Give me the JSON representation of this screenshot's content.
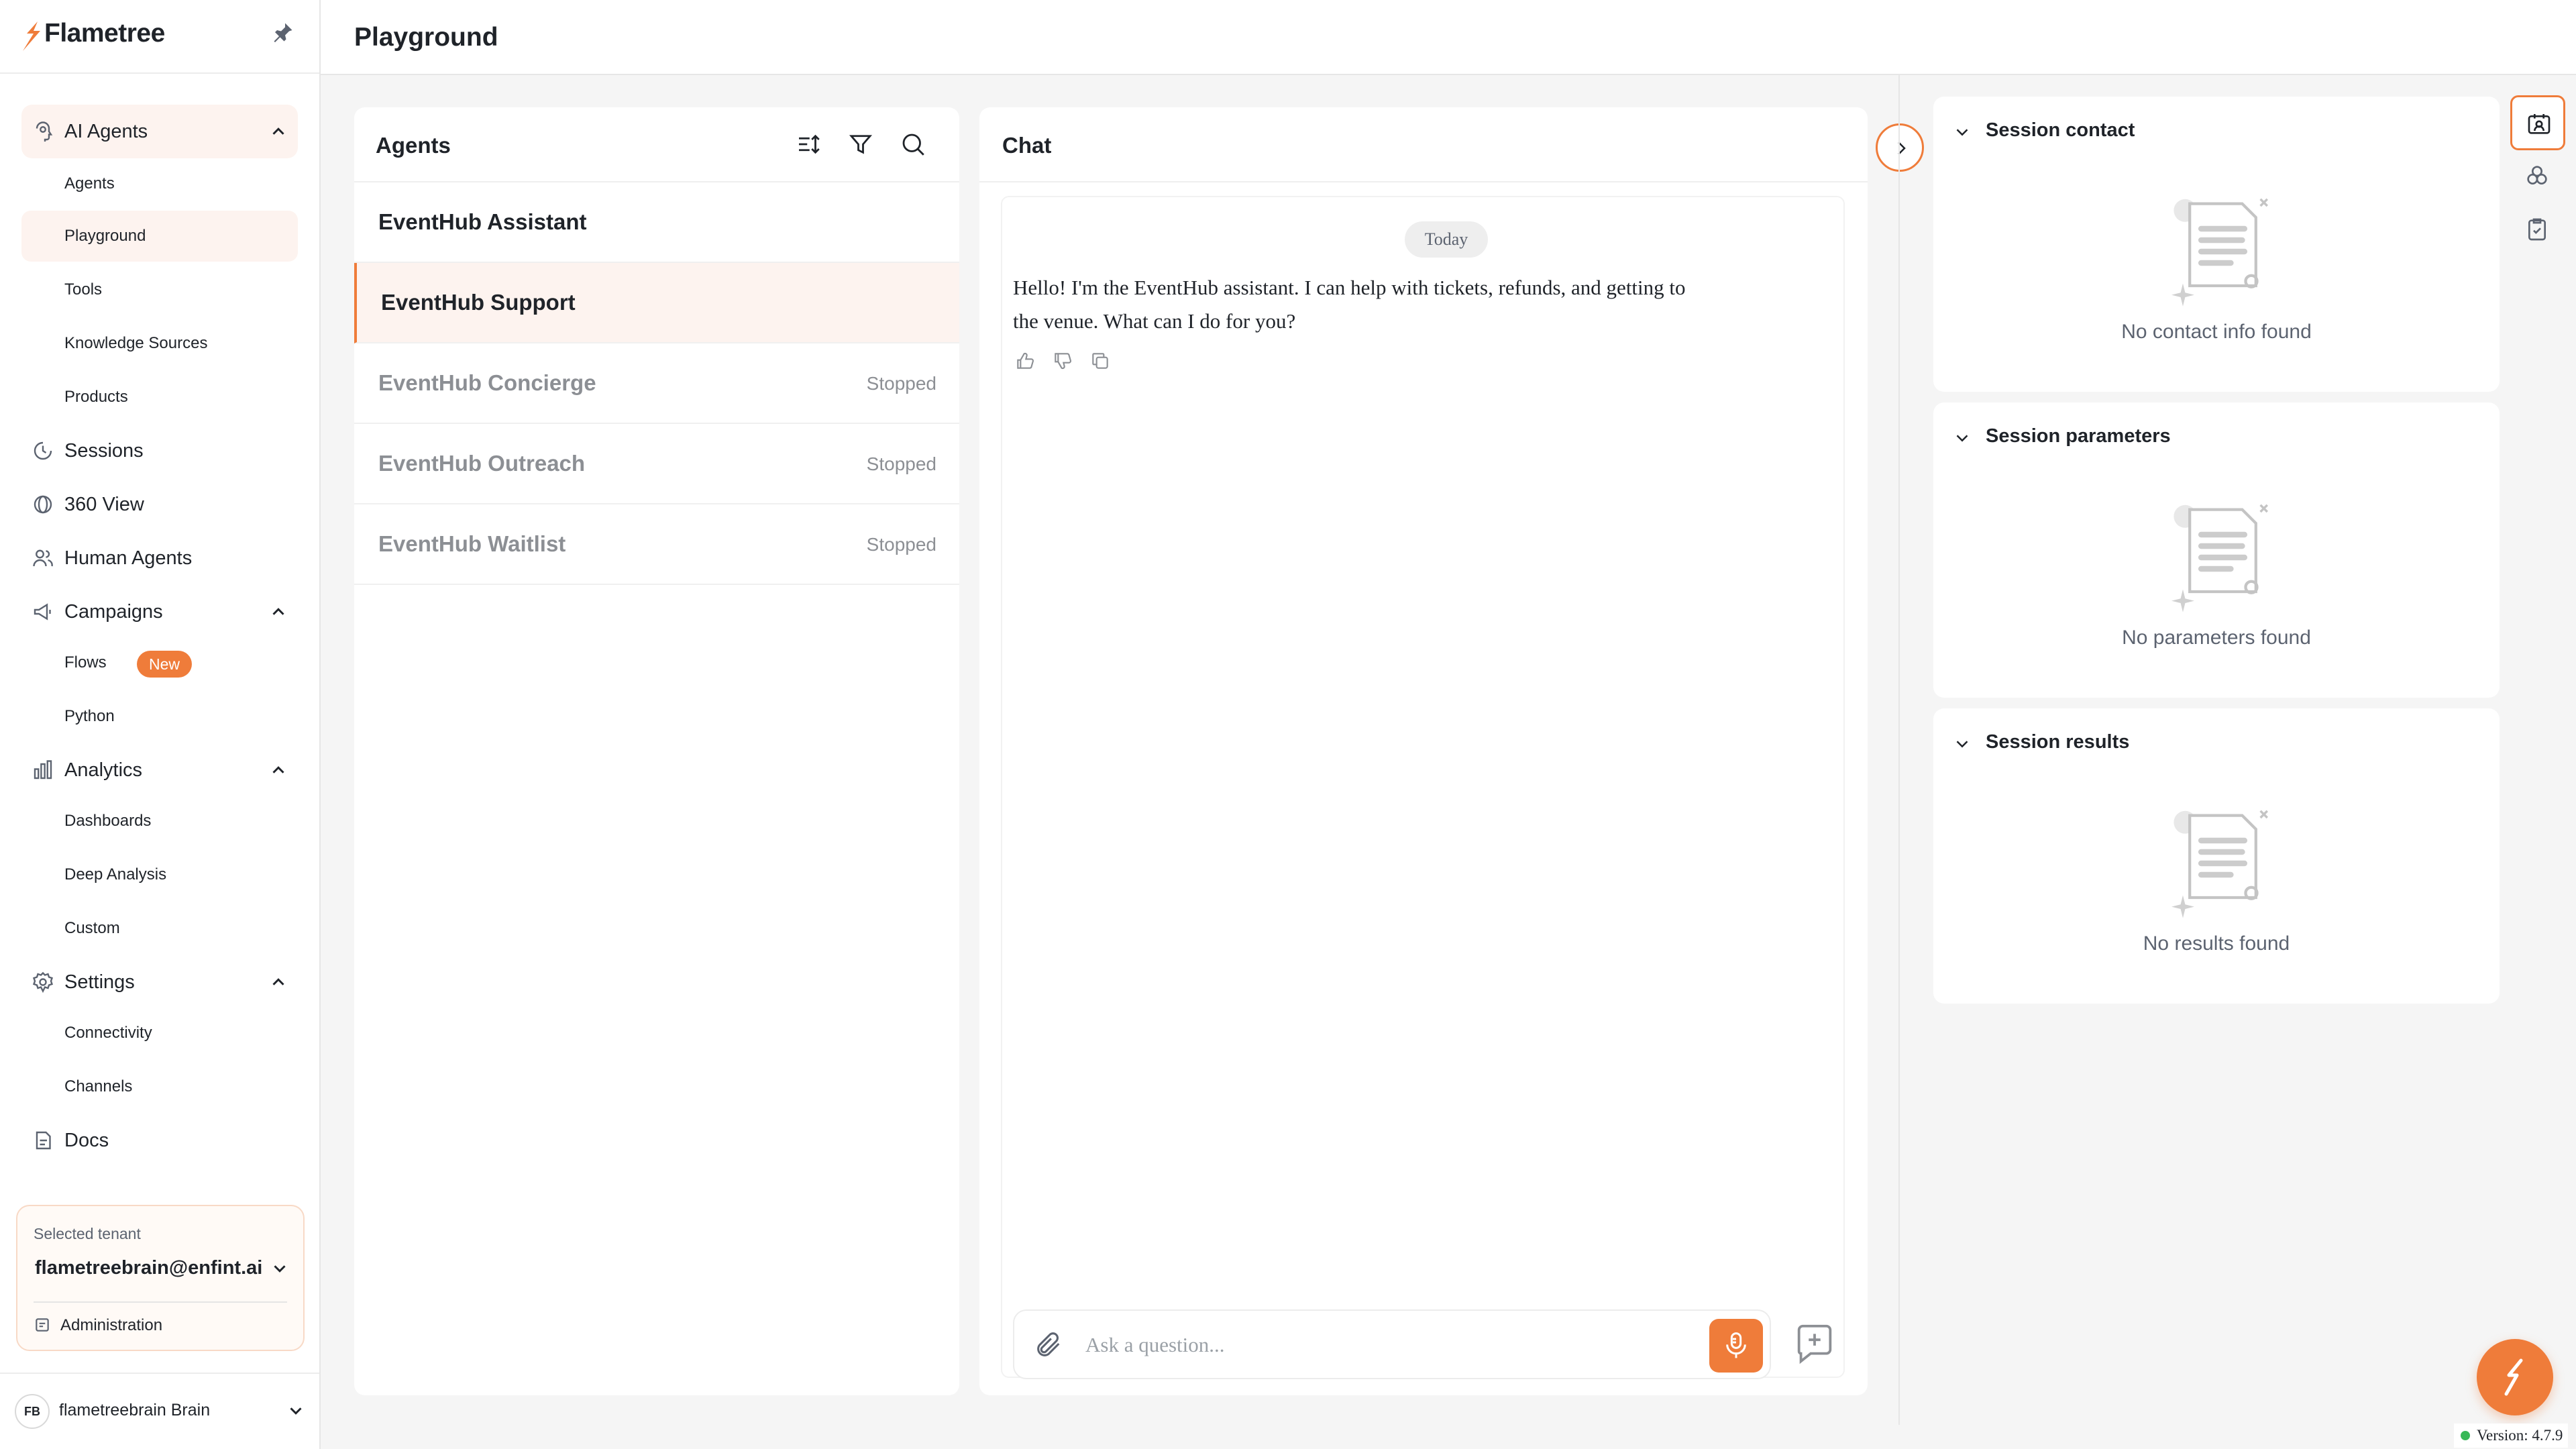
{
  "app": {
    "name": "Flametree",
    "page_title": "Playground"
  },
  "colors": {
    "accent": "#ef7c3a",
    "accent_soft": "#fdf3ef",
    "status_online": "#38b857"
  },
  "sidebar": {
    "groups": [
      {
        "label": "AI Agents",
        "icon": "ai-agents-icon",
        "items": [
          "Agents",
          "Playground",
          "Tools",
          "Knowledge Sources",
          "Products"
        ]
      },
      {
        "label": "Sessions",
        "icon": "clock-icon"
      },
      {
        "label": "360 View",
        "icon": "globe-icon"
      },
      {
        "label": "Human Agents",
        "icon": "users-icon"
      },
      {
        "label": "Campaigns",
        "icon": "megaphone-icon",
        "items": [
          "Flows",
          "Python"
        ],
        "badge": "New"
      },
      {
        "label": "Analytics",
        "icon": "bar-chart-icon",
        "items": [
          "Dashboards",
          "Deep Analysis",
          "Custom"
        ]
      },
      {
        "label": "Settings",
        "icon": "gear-icon",
        "items": [
          "Connectivity",
          "Channels"
        ]
      },
      {
        "label": "Docs",
        "icon": "docs-icon"
      }
    ],
    "active_item": "Playground",
    "tenant": {
      "caption": "Selected tenant",
      "name": "flametreebrain@enfint.ai",
      "admin_label": "Administration"
    },
    "user": {
      "initials": "FB",
      "name": "flametreebrain Brain"
    }
  },
  "agents_panel": {
    "title": "Agents",
    "agents": [
      {
        "name": "EventHub Assistant",
        "status": ""
      },
      {
        "name": "EventHub Support",
        "status": ""
      },
      {
        "name": "EventHub Concierge",
        "status": "Stopped"
      },
      {
        "name": "EventHub Outreach",
        "status": "Stopped"
      },
      {
        "name": "EventHub Waitlist",
        "status": "Stopped"
      }
    ],
    "selected_index": 1
  },
  "chat": {
    "title": "Chat",
    "day_label": "Today",
    "message": "Hello! I'm the EventHub assistant. I can help with tickets, refunds, and getting to the venue. What can I do for you?",
    "input_placeholder": "Ask a question..."
  },
  "session": {
    "cards": [
      {
        "title": "Session contact",
        "empty_text": "No contact info found"
      },
      {
        "title": "Session parameters",
        "empty_text": "No parameters found"
      },
      {
        "title": "Session results",
        "empty_text": "No results found"
      }
    ]
  },
  "version": "Version: 4.7.9"
}
